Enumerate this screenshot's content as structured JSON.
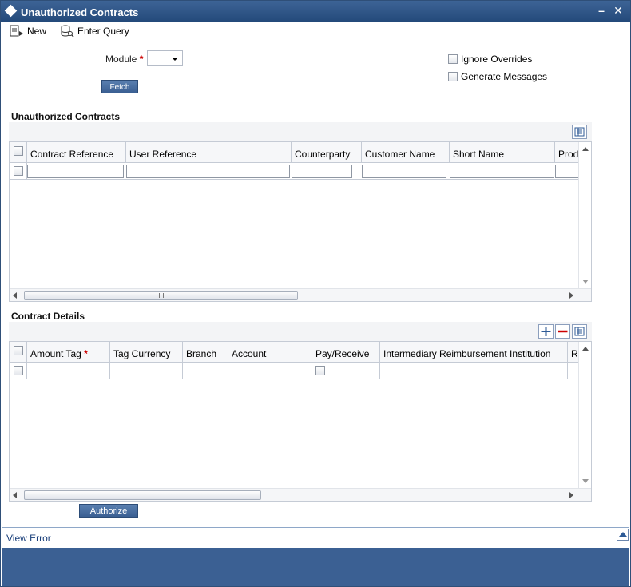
{
  "window": {
    "title": "Unauthorized Contracts"
  },
  "toolbar": {
    "new_label": "New",
    "enter_query_label": "Enter Query"
  },
  "form": {
    "module_label": "Module",
    "required_mark": "*",
    "module_value": "",
    "fetch_label": "Fetch",
    "ignore_overrides_label": "Ignore Overrides",
    "generate_messages_label": "Generate Messages"
  },
  "unauthorized_contracts": {
    "title": "Unauthorized Contracts",
    "columns": [
      "Contract Reference",
      "User Reference",
      "Counterparty",
      "Customer Name",
      "Short Name",
      "Prod"
    ]
  },
  "contract_details": {
    "title": "Contract Details",
    "columns": [
      "Amount Tag",
      "Tag Currency",
      "Branch",
      "Account",
      "Pay/Receive",
      "Intermediary Reimbursement Institution",
      "R"
    ],
    "amount_tag_required": "*"
  },
  "authorize_label": "Authorize",
  "footer": {
    "view_error_label": "View Error"
  },
  "icons": {
    "title": "diamond-icon",
    "new": "new-document-icon",
    "query": "query-icon",
    "grid_settings": "list-icon",
    "add_row": "plus-icon",
    "delete_row": "minus-icon"
  },
  "colors": {
    "titlebar": "#2d5283",
    "button": "#4a6fa2",
    "footer": "#3b6093",
    "delete": "#cc0000"
  }
}
